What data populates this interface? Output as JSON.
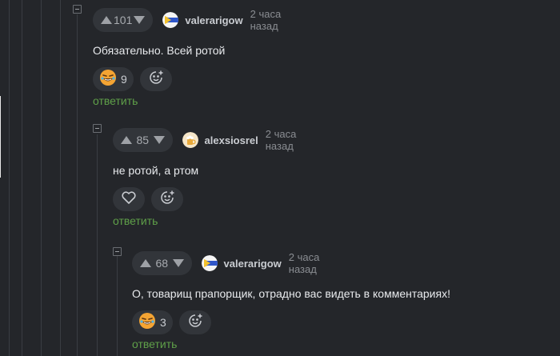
{
  "comments": [
    {
      "score": "101",
      "username": "valerarigow",
      "time": "2 часа назад",
      "text": "Обязательно. Всей ротой",
      "reaction_count": "9",
      "reply_label": "ответить",
      "avatar_icon": "flag-avatar-icon",
      "reaction_icon": "laughing-emoji-icon"
    },
    {
      "score": "85",
      "username": "alexsiosrel",
      "time": "2 часа назад",
      "text": "не ротой, а ртом",
      "reply_label": "ответить",
      "avatar_icon": "beer-avatar-icon",
      "reaction_icon": "heart-icon"
    },
    {
      "score": "68",
      "username": "valerarigow",
      "time": "2 часа назад",
      "text": "О, товарищ прапорщик, отрадно вас видеть в комментариях!",
      "reaction_count": "3",
      "reply_label": "ответить",
      "avatar_icon": "flag-avatar-icon",
      "reaction_icon": "laughing-emoji-icon"
    }
  ],
  "colors": {
    "background": "#24262a",
    "pill": "#32353a",
    "reply_link": "#5fa049",
    "avatar_blue": "#2f56c9",
    "avatar_yellow": "#f2c12e"
  }
}
